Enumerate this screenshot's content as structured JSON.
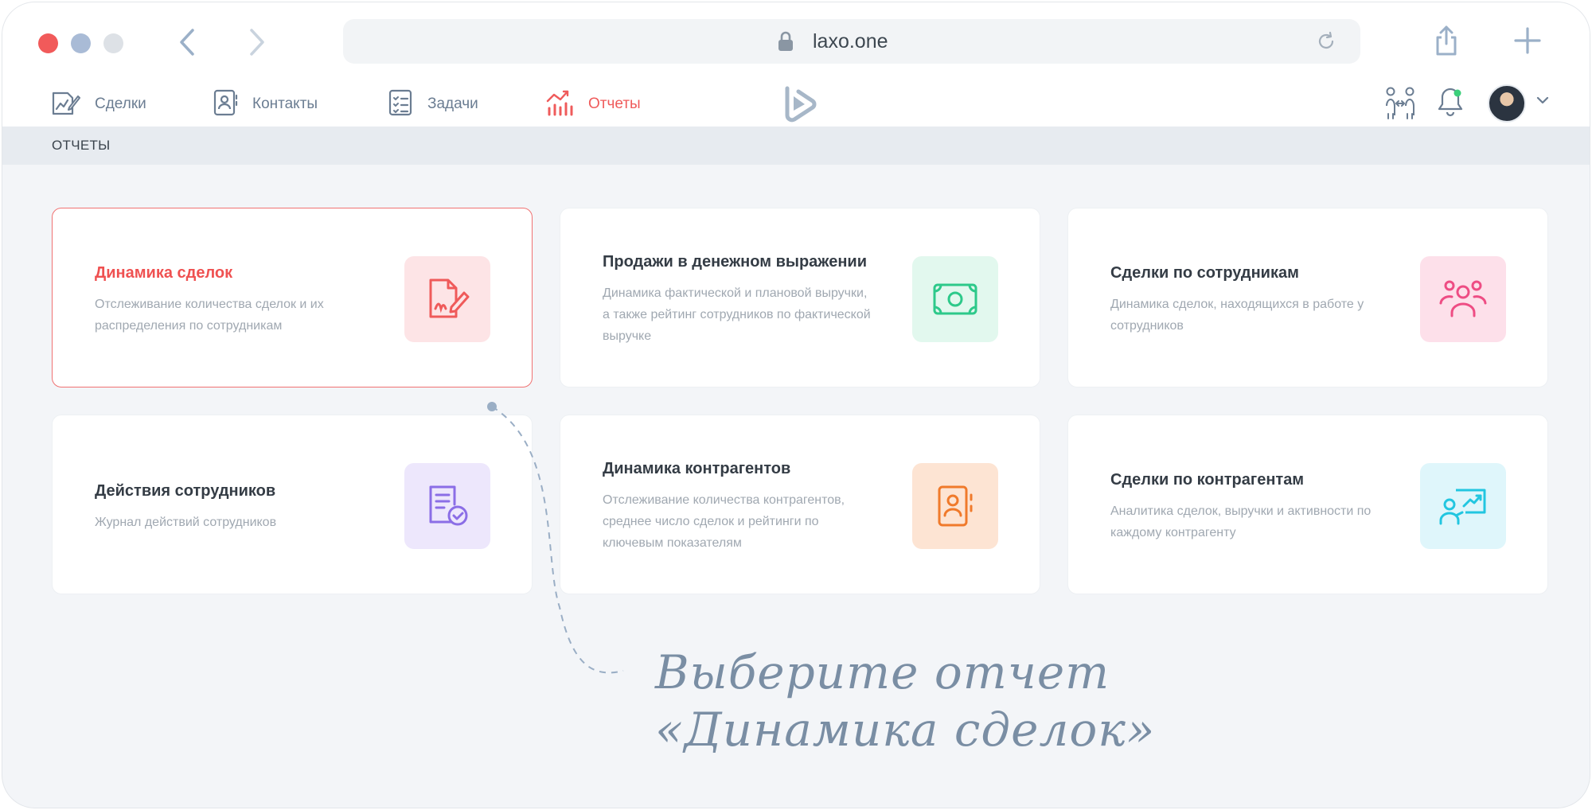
{
  "browser": {
    "url": "laxo.one"
  },
  "nav": {
    "items": [
      {
        "label": "Сделки",
        "icon": "deal-edit-icon"
      },
      {
        "label": "Контакты",
        "icon": "contact-book-icon"
      },
      {
        "label": "Задачи",
        "icon": "checklist-icon"
      },
      {
        "label": "Отчеты",
        "icon": "chart-icon",
        "active": true
      }
    ]
  },
  "section": {
    "title": "ОТЧЕТЫ"
  },
  "cards": [
    {
      "title": "Динамика сделок",
      "description": "Отслеживание количества сделок и их распределения по сотрудникам",
      "icon": "document-signature-icon",
      "icon_bg": "#fde4e6",
      "icon_color": "#ef5a5a",
      "selected": true
    },
    {
      "title": "Продажи в денежном выражении",
      "description": "Динамика фактической и плановой выручки, а также рейтинг сотрудников по фактической выручке",
      "icon": "banknote-icon",
      "icon_bg": "#e2f8ee",
      "icon_color": "#2dc98a"
    },
    {
      "title": "Сделки по сотрудникам",
      "description": "Динамика сделок, находящихся в работе у сотрудников",
      "icon": "users-group-icon",
      "icon_bg": "#fde0ea",
      "icon_color": "#ee4d84"
    },
    {
      "title": "Действия сотрудников",
      "description": "Журнал действий сотрудников",
      "icon": "document-check-icon",
      "icon_bg": "#ede7fc",
      "icon_color": "#8b6ee6"
    },
    {
      "title": "Динамика контрагентов",
      "description": "Отслеживание количества контрагентов, среднее число сделок и рейтинги по ключевым показателям",
      "icon": "address-book-icon",
      "icon_bg": "#fde4d3",
      "icon_color": "#f07a2b"
    },
    {
      "title": "Сделки по контрагентам",
      "description": "Аналитика сделок, выручки и активности по каждому контрагенту",
      "icon": "presentation-user-icon",
      "icon_bg": "#dff6fb",
      "icon_color": "#22c6e0"
    }
  ],
  "annotation": {
    "line1": "Выберите отчет",
    "line2": "«Динамика сделок»"
  }
}
